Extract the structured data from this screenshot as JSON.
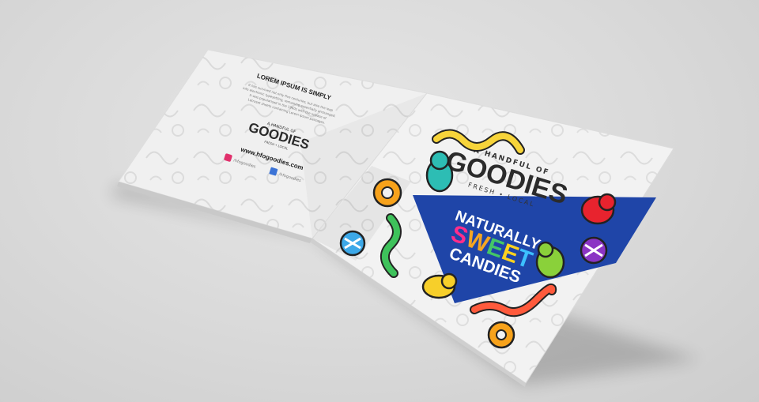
{
  "back_cover": {
    "heading": "LOREM IPSUM IS SIMPLY",
    "body_lines": [
      "It has survived not only five centuries, but also the leap",
      "into electronic typesetting, remaining essentially unchanged.",
      "It was popularised in the 1960s with the release of",
      "Letraset sheets containing Lorem Ipsum passages."
    ],
    "logo_top": "A HANDFUL OF",
    "logo_main": "GOODIES",
    "logo_sub": "FRESH • LOCAL",
    "website": "www.hfogoodies.com",
    "instagram_handle": "/hfogoodies",
    "facebook_handle": "/hfogoodies"
  },
  "front_cover": {
    "logo_top": "A HANDFUL OF",
    "logo_main": "GOODIES",
    "logo_sub": "FRESH • LOCAL",
    "banner_line1": "NATURALLY",
    "banner_line2_letters": [
      "S",
      "W",
      "E",
      "E",
      "T"
    ],
    "banner_line2_colors": [
      "#ff2d8a",
      "#f5a623",
      "#44c767",
      "#ffd21f",
      "#3cc0ff"
    ],
    "banner_line3": "CANDIES"
  },
  "colors": {
    "banner_blue": "#1f45a8",
    "instagram": "#e1306c",
    "facebook": "#3b73d6",
    "background": "#dcdcdc"
  }
}
